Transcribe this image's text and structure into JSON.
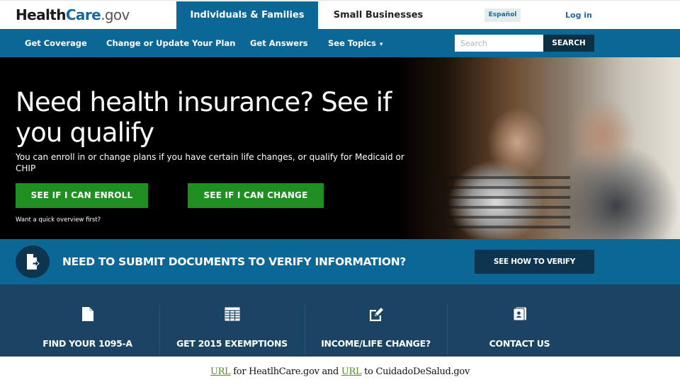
{
  "header": {
    "logo": {
      "health": "Health",
      "care": "Care",
      "gov": ".gov"
    },
    "tabs": [
      {
        "label": "Individuals & Families",
        "active": true
      },
      {
        "label": "Small Businesses",
        "active": false
      }
    ],
    "language_button": "Español",
    "login_link": "Log in"
  },
  "subnav": {
    "items": [
      {
        "label": "Get Coverage"
      },
      {
        "label": "Change or Update Your Plan"
      },
      {
        "label": "Get Answers"
      },
      {
        "label": "See Topics",
        "has_dropdown": true,
        "caret": "▾"
      }
    ],
    "search": {
      "placeholder": "Search",
      "value": "",
      "button_label": "SEARCH"
    }
  },
  "hero": {
    "title": "Need health insurance? See if you qualify",
    "subtitle": "You can enroll in or change plans if you have certain life changes, or qualify for Medicaid or CHIP",
    "buttons": [
      {
        "label": "SEE IF I CAN ENROLL"
      },
      {
        "label": "SEE IF I CAN CHANGE"
      }
    ],
    "overview_link": "Want a quick overview first?"
  },
  "verify_banner": {
    "icon": "document-arrow-icon",
    "text": "NEED TO SUBMIT DOCUMENTS TO VERIFY INFORMATION?",
    "button_label": "SEE HOW TO VERIFY"
  },
  "quick_links": [
    {
      "icon": "document-icon",
      "label": "FIND YOUR 1095-A"
    },
    {
      "icon": "spreadsheet-icon",
      "label": "GET 2015 EXEMPTIONS"
    },
    {
      "icon": "edit-icon",
      "label": "INCOME/LIFE CHANGE?"
    },
    {
      "icon": "contact-card-icon",
      "label": "CONTACT US"
    }
  ],
  "caption": {
    "link1": "URL",
    "text1": " for HeatlhCare.gov and ",
    "link2": "URL",
    "text2": " to CuidadoDeSalud.gov"
  },
  "colors": {
    "brand_blue": "#0b6896",
    "dark_navy": "#0d3550",
    "quick_links_bg": "#1b4464",
    "cta_green": "#1f8f24",
    "caption_link": "#5a8a2a"
  }
}
